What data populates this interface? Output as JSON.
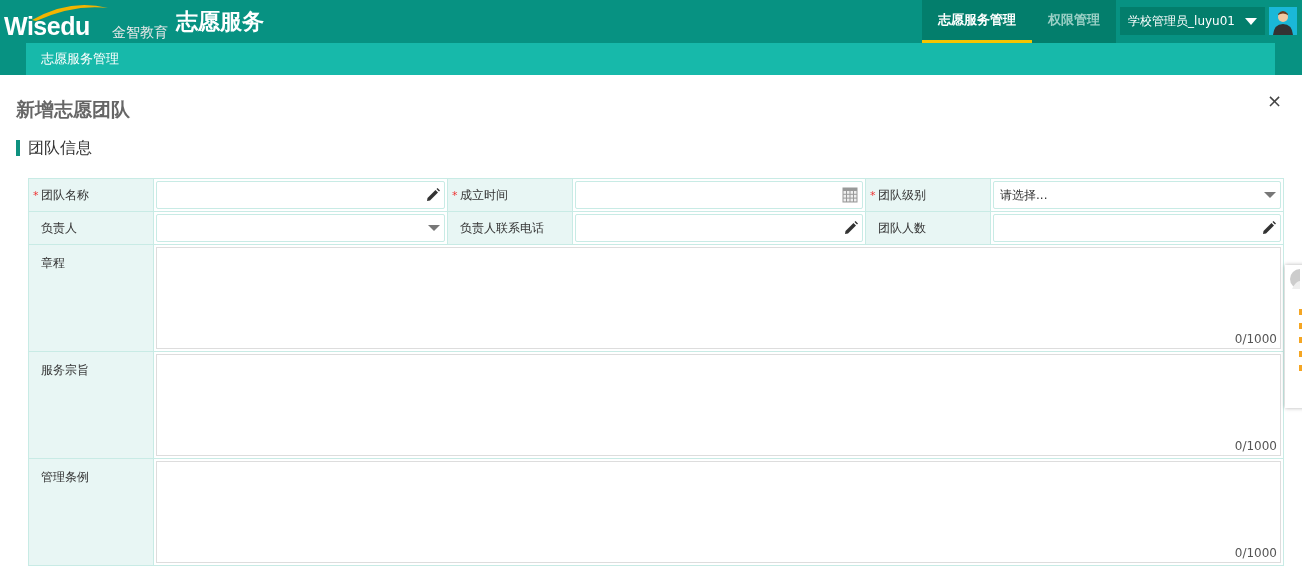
{
  "header": {
    "logo": "Wisedu",
    "logo_subtitle": "金智教育",
    "app_title": "志愿服务",
    "nav": [
      {
        "label": "志愿服务管理",
        "selected": true
      },
      {
        "label": "权限管理",
        "selected": false
      }
    ],
    "user": "学校管理员_luyu01"
  },
  "breadcrumb": "志愿服务管理",
  "dialog": {
    "title": "新增志愿团队",
    "close": "×",
    "section": "团队信息",
    "required_mark": "*",
    "rows": [
      [
        {
          "label": "团队名称",
          "required": true,
          "kind": "text"
        },
        {
          "label": "成立时间",
          "required": true,
          "kind": "date"
        },
        {
          "label": "团队级别",
          "required": true,
          "kind": "select",
          "placeholder": "请选择..."
        }
      ],
      [
        {
          "label": "负责人",
          "required": false,
          "kind": "select"
        },
        {
          "label": "负责人联系电话",
          "required": false,
          "kind": "text"
        },
        {
          "label": "团队人数",
          "required": false,
          "kind": "text"
        }
      ]
    ],
    "textareas": [
      {
        "label": "章程",
        "counter": "0/1000"
      },
      {
        "label": "服务宗旨",
        "counter": "0/1000"
      },
      {
        "label": "管理条例",
        "counter": "0/1000"
      }
    ]
  }
}
